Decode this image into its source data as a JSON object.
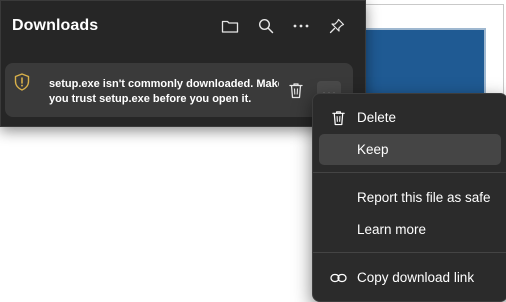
{
  "panel": {
    "title": "Downloads",
    "icons": [
      "folder-icon",
      "search-icon",
      "more-icon",
      "pin-icon"
    ]
  },
  "item": {
    "line1": "setup.exe isn't commonly downloaded. Make sure",
    "line2": "you trust setup.exe before you open it.",
    "status_color": "#d8b04a"
  },
  "menu": {
    "items": [
      {
        "label": "Delete",
        "icon": "delete-icon"
      },
      {
        "label": "Keep",
        "icon": ""
      },
      {
        "label": "Report this file as safe",
        "icon": ""
      },
      {
        "label": "Learn more",
        "icon": ""
      },
      {
        "label": "Copy download link",
        "icon": "link-icon"
      }
    ]
  }
}
